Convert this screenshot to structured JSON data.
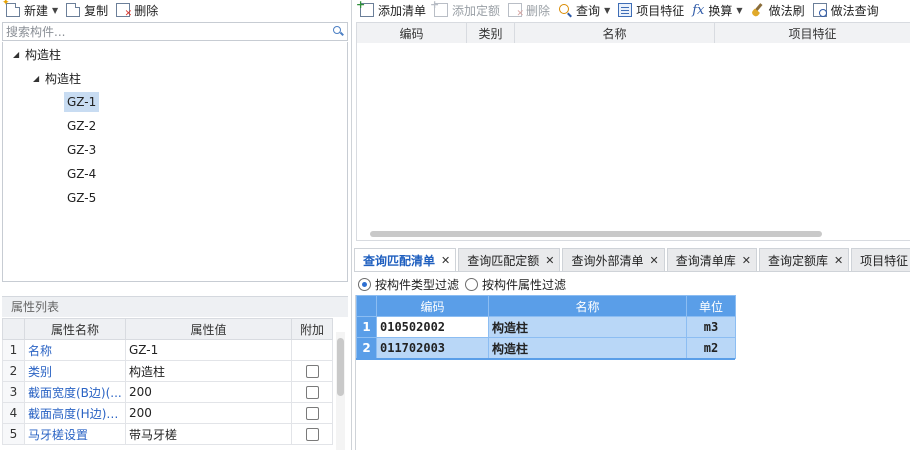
{
  "left_toolbar": {
    "new_label": "新建",
    "copy_label": "复制",
    "delete_label": "删除"
  },
  "search": {
    "placeholder": "搜索构件..."
  },
  "tree": {
    "root": "构造柱",
    "group": "构造柱",
    "items": [
      "GZ-1",
      "GZ-2",
      "GZ-3",
      "GZ-4",
      "GZ-5"
    ],
    "selected": "GZ-1"
  },
  "properties": {
    "panel_title": "属性列表",
    "headers": {
      "name": "属性名称",
      "value": "属性值",
      "extra": "附加"
    },
    "rows": [
      {
        "num": "1",
        "name": "名称",
        "value": "GZ-1",
        "has_checkbox": false
      },
      {
        "num": "2",
        "name": "类别",
        "value": "构造柱",
        "has_checkbox": true
      },
      {
        "num": "3",
        "name": "截面宽度(B边)(...",
        "value": "200",
        "has_checkbox": true
      },
      {
        "num": "4",
        "name": "截面高度(H边)(...",
        "value": "200",
        "has_checkbox": true
      },
      {
        "num": "5",
        "name": "马牙槎设置",
        "value": "带马牙槎",
        "has_checkbox": true
      }
    ]
  },
  "right_toolbar": {
    "add_list": "添加清单",
    "add_quota": "添加定额",
    "delete": "删除",
    "query": "查询",
    "item_feature": "项目特征",
    "convert": "换算",
    "method_brush": "做法刷",
    "method_query": "做法查询"
  },
  "list_grid": {
    "headers": [
      "编码",
      "类别",
      "名称",
      "项目特征"
    ]
  },
  "tabs": [
    {
      "label": "查询匹配清单",
      "active": true
    },
    {
      "label": "查询匹配定额",
      "active": false
    },
    {
      "label": "查询外部清单",
      "active": false
    },
    {
      "label": "查询清单库",
      "active": false
    },
    {
      "label": "查询定额库",
      "active": false
    },
    {
      "label": "项目特征",
      "active": false
    }
  ],
  "filters": {
    "by_type": "按构件类型过滤",
    "by_attr": "按构件属性过滤",
    "selected": "by_type"
  },
  "results": {
    "headers": {
      "code": "编码",
      "name": "名称",
      "unit": "单位"
    },
    "rows": [
      {
        "num": "1",
        "code": "010502002",
        "name": "构造柱",
        "unit": "m3"
      },
      {
        "num": "2",
        "code": "011702003",
        "name": "构造柱",
        "unit": "m2"
      }
    ]
  },
  "colors": {
    "accent": "#1f5fbf",
    "grid_header_blue": "#5a9ee8",
    "row_highlight": "#b9d7f7",
    "tree_selection": "#c8dcf2",
    "property_link": "#2a63c4"
  }
}
